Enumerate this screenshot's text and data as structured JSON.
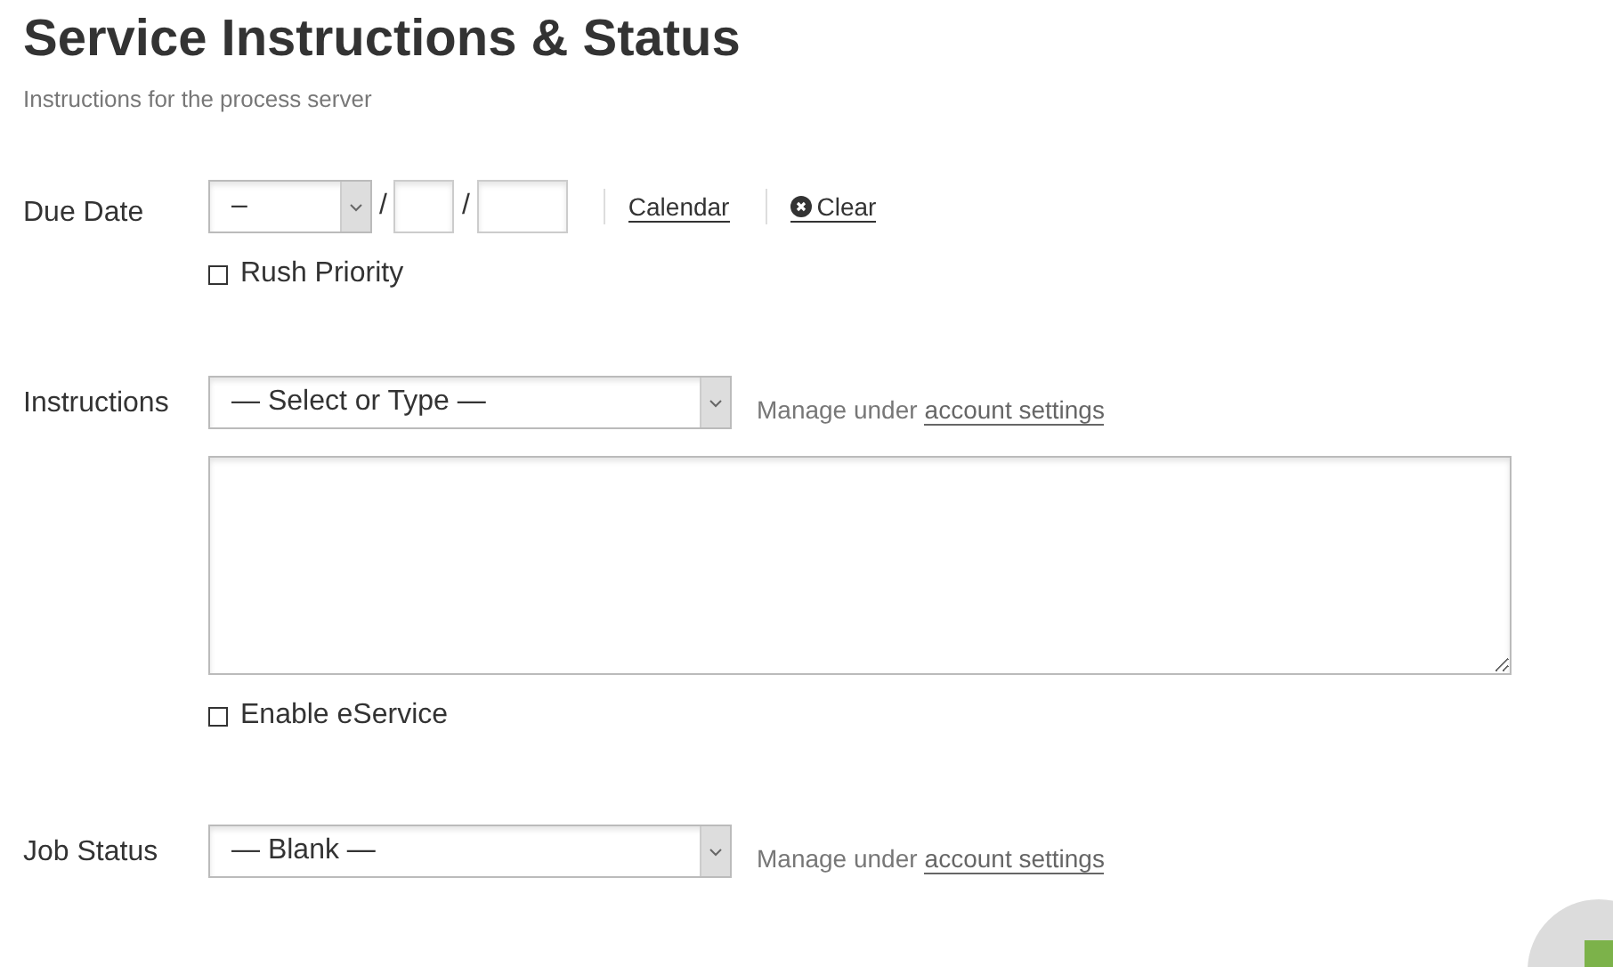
{
  "page": {
    "title": "Service Instructions & Status",
    "subtitle": "Instructions for the process server"
  },
  "due_date": {
    "label": "Due Date",
    "month": {
      "value": "–"
    },
    "separators": [
      "/",
      "/"
    ],
    "calendar_link": "Calendar",
    "clear_link": "Clear",
    "rush": {
      "label": "Rush Priority",
      "checked": false
    }
  },
  "instructions": {
    "label": "Instructions",
    "select": {
      "value": "— Select or Type —"
    },
    "hint": "Manage under",
    "link": "account settings",
    "eservice": {
      "label": "Enable eService",
      "checked": false
    }
  },
  "job_status": {
    "label": "Job Status",
    "select": {
      "value": "— Blank —"
    },
    "hint": "Manage under",
    "link": "account settings"
  }
}
